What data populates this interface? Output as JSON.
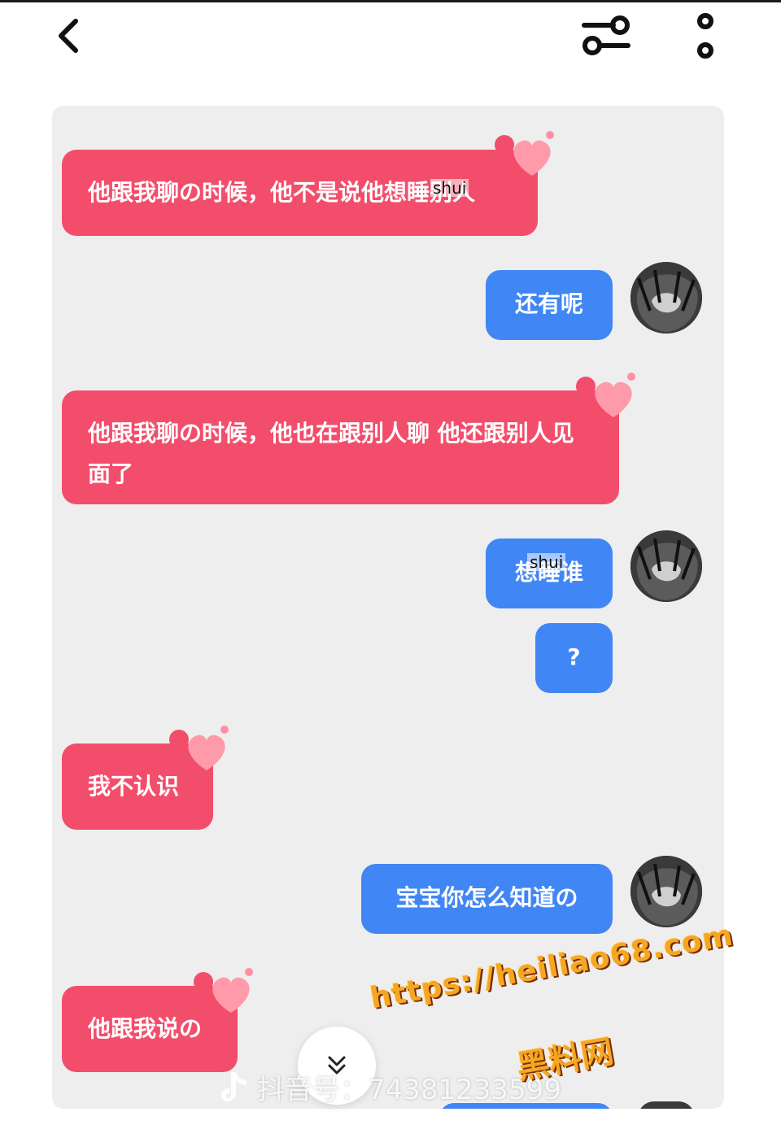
{
  "header": {
    "back_icon": "chevron-left-icon",
    "filter_icon": "sliders-icon",
    "more_icon": "more-vertical-icon"
  },
  "messages": [
    {
      "side": "left",
      "text": "他跟我聊の时候，他不是说他想睡别人",
      "overlay": "shui"
    },
    {
      "side": "right",
      "text": "还有呢"
    },
    {
      "side": "left",
      "text": "他跟我聊の时候，他也在跟别人聊 他还跟别人见面了"
    },
    {
      "side": "right",
      "text": "想睡谁",
      "overlay": "shui"
    },
    {
      "side": "right",
      "text": "?"
    },
    {
      "side": "left",
      "text": "我不认识"
    },
    {
      "side": "right",
      "text": "宝宝你怎么知道の"
    },
    {
      "side": "left",
      "text": "他跟我说の"
    }
  ],
  "scroll_down_icon": "double-chevron-down-icon",
  "douyin_id": "抖音号：74381233599",
  "watermark": {
    "url": "https://heiliao68.com",
    "name": "黑料网"
  },
  "colors": {
    "left_bubble": "#f24e6c",
    "right_bubble": "#4186f5",
    "panel": "#eeeeef"
  }
}
